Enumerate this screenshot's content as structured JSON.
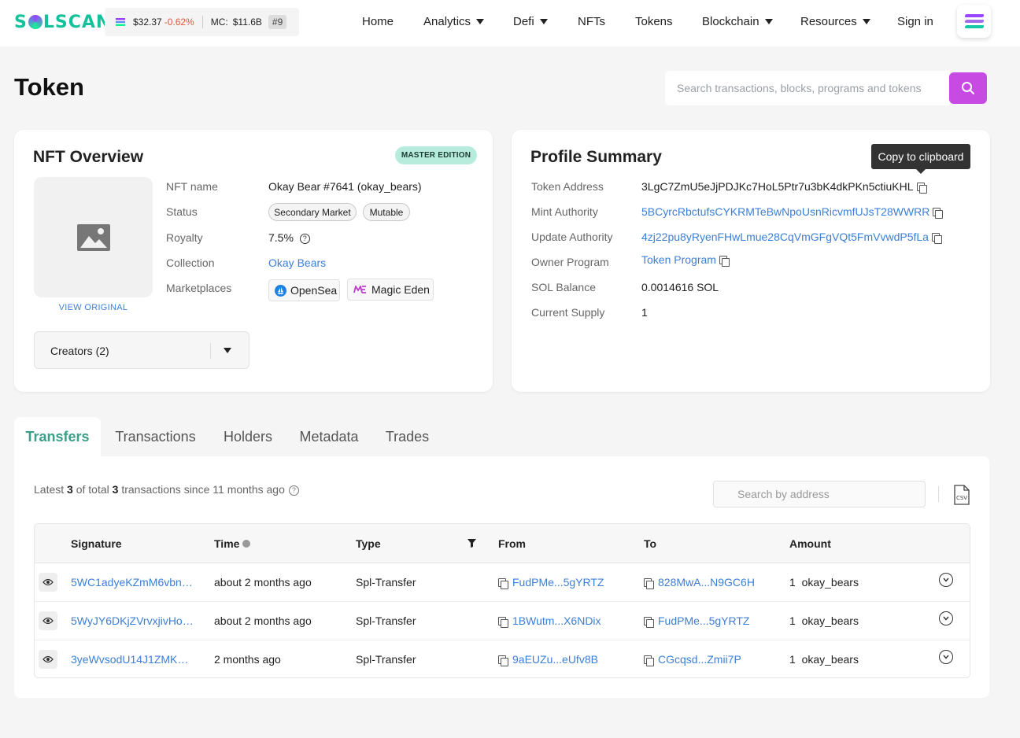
{
  "nav": {
    "logo": "SOLSCAN",
    "price": "$32.37",
    "price_change": "-0.62%",
    "mc_label": "MC:",
    "mc_value": "$11.6B",
    "rank": "#9",
    "items": [
      "Home",
      "Analytics",
      "Defi",
      "NFTs",
      "Tokens",
      "Blockchain",
      "Resources",
      "Sign in"
    ]
  },
  "header": {
    "title": "Token",
    "search_placeholder": "Search transactions, blocks, programs and tokens"
  },
  "nft": {
    "title": "NFT Overview",
    "badge": "MASTER EDITION",
    "view_original": "VIEW ORIGINAL",
    "labels": [
      "NFT name",
      "Status",
      "Royalty",
      "Collection",
      "Marketplaces"
    ],
    "name": "Okay Bear #7641 (okay_bears)",
    "status_tags": [
      "Secondary Market",
      "Mutable"
    ],
    "royalty": "7.5%",
    "collection": "Okay Bears",
    "marketplaces": [
      "OpenSea",
      "Magic Eden"
    ],
    "creators": "Creators (2)"
  },
  "profile": {
    "title": "Profile Summary",
    "tooltip": "Copy to clipboard",
    "labels": [
      "Token Address",
      "Mint Authority",
      "Update Authority",
      "Owner Program",
      "SOL Balance",
      "Current Supply"
    ],
    "token_address": "3LgC7ZmU5eJjPDJKc7HoL5Ptr7u3bK4dkPKn5ctiuKHL",
    "mint_authority": "5BCyrcRbctufsCYKRMTeBwNpoUsnRicvmfUJsT28WWRR",
    "update_authority": "4zj22pu8yRyenFHwLmue28CqVmGFgVQt5FmVvwdP5fLa",
    "owner_program": "Token Program",
    "sol_balance": "0.0014616 SOL",
    "current_supply": "1"
  },
  "tabs": [
    "Transfers",
    "Transactions",
    "Holders",
    "Metadata",
    "Trades"
  ],
  "transfers": {
    "summary_pre": "Latest",
    "latest": "3",
    "summary_mid": "of total",
    "total": "3",
    "summary_post": "transactions since 11 months ago",
    "search_placeholder": "Search by address",
    "columns": [
      "Signature",
      "Time",
      "Type",
      "From",
      "To",
      "Amount"
    ],
    "rows": [
      {
        "signature": "5WC1adyeKZmM6vbn…",
        "time": "about 2 months ago",
        "type": "Spl-Transfer",
        "from": "FudPMe...5gYRTZ",
        "to": "828MwA...N9GC6H",
        "amount": "1",
        "token": "okay_bears"
      },
      {
        "signature": "5WyJY6DKjZVrvxjivHo…",
        "time": "about 2 months ago",
        "type": "Spl-Transfer",
        "from": "1BWutm...X6NDix",
        "to": "FudPMe...5gYRTZ",
        "amount": "1",
        "token": "okay_bears"
      },
      {
        "signature": "3yeWvsodU14J1ZMK…",
        "time": "2 months ago",
        "type": "Spl-Transfer",
        "from": "9aEUZu...eUfv8B",
        "to": "CGcqsd...Zmii7P",
        "amount": "1",
        "token": "okay_bears"
      }
    ]
  },
  "colors": {
    "accent": "#c74ae3",
    "brand": "#13c29a",
    "link": "#3c7fd6",
    "negative": "#e5573c"
  }
}
